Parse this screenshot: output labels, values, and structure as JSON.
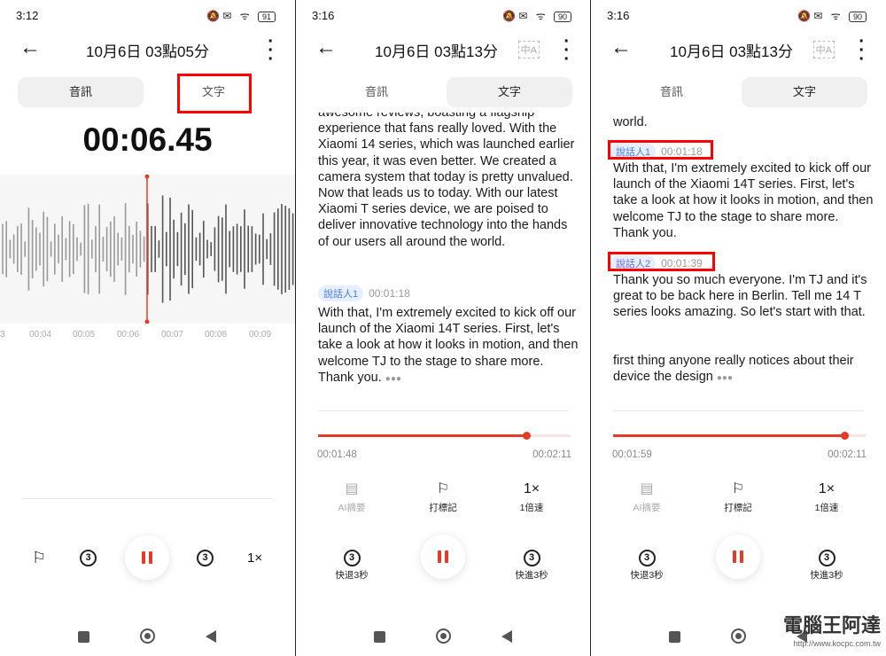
{
  "panels": [
    {
      "status_time": "3:12",
      "battery": "91",
      "title": "10月6日 03點05分",
      "tabs": {
        "audio": "音訊",
        "text": "文字"
      },
      "selected_tab": "audio",
      "timer": "00:06.45",
      "ticks": [
        "3",
        "00:04",
        "00:05",
        "00:06",
        "00:07",
        "00:08",
        "00:09"
      ],
      "controls": {
        "mark": "flag-icon",
        "rewind": "3",
        "forward": "3",
        "speed": "1×"
      }
    },
    {
      "status_time": "3:16",
      "battery": "90",
      "title": "10月6日 03點13分",
      "tabs": {
        "audio": "音訊",
        "text": "文字"
      },
      "selected_tab": "text",
      "transcript": {
        "para1": "awesome reviews, boasting a flagship experience that fans really loved. With the Xiaomi 14 series, which was launched earlier this year, it was even better. We created a camera system that today is pretty unvalued. Now that leads us to today. With our latest Xiaomi T series device, we are poised to deliver innovative technology into the hands of our users all around the world.",
        "speaker1": "說話人1",
        "time1": "00:01:18",
        "para2": "With that, I'm extremely excited to kick off our launch of the Xiaomi 14T series. First, let's take a look at how it looks in motion, and then welcome TJ to the stage to share more. Thank you."
      },
      "progress": {
        "current": "00:01:48",
        "total": "00:02:11",
        "fraction": 0.824
      },
      "buttons": {
        "ai": "AI摘要",
        "mark": "打標記",
        "speed_icon": "1×",
        "speed": "1倍速",
        "rewind": "快退3秒",
        "forward": "快進3秒",
        "rewind_n": "3",
        "forward_n": "3"
      }
    },
    {
      "status_time": "3:16",
      "battery": "90",
      "title": "10月6日 03點13分",
      "tabs": {
        "audio": "音訊",
        "text": "文字"
      },
      "selected_tab": "text",
      "transcript": {
        "para0": "world.",
        "speaker1": "說話人1",
        "time1": "00:01:18",
        "para1": "With that, I'm extremely excited to kick off our launch of the Xiaomi 14T series. First, let's take a look at how it looks in motion, and then welcome TJ to the stage to share more. Thank you.",
        "speaker2": "說話人2",
        "time2": "00:01:39",
        "para2": "Thank you so much everyone. I'm TJ and it's great to be back here in Berlin. Tell me 14 T series looks amazing. So let's start with that.",
        "para3": "first thing anyone really notices about their device the design"
      },
      "progress": {
        "current": "00:01:59",
        "total": "00:02:11",
        "fraction": 0.916
      },
      "buttons": {
        "ai": "AI摘要",
        "mark": "打標記",
        "speed_icon": "1×",
        "speed": "1倍速",
        "rewind": "快退3秒",
        "forward": "快進3秒",
        "rewind_n": "3",
        "forward_n": "3"
      }
    }
  ],
  "watermark": {
    "name": "電腦王阿達",
    "url": "http://www.kocpc.com.tw"
  },
  "colors": {
    "accent": "#e53a25",
    "highlight_box": "#ff0000",
    "tag_bg": "#e6efff"
  }
}
